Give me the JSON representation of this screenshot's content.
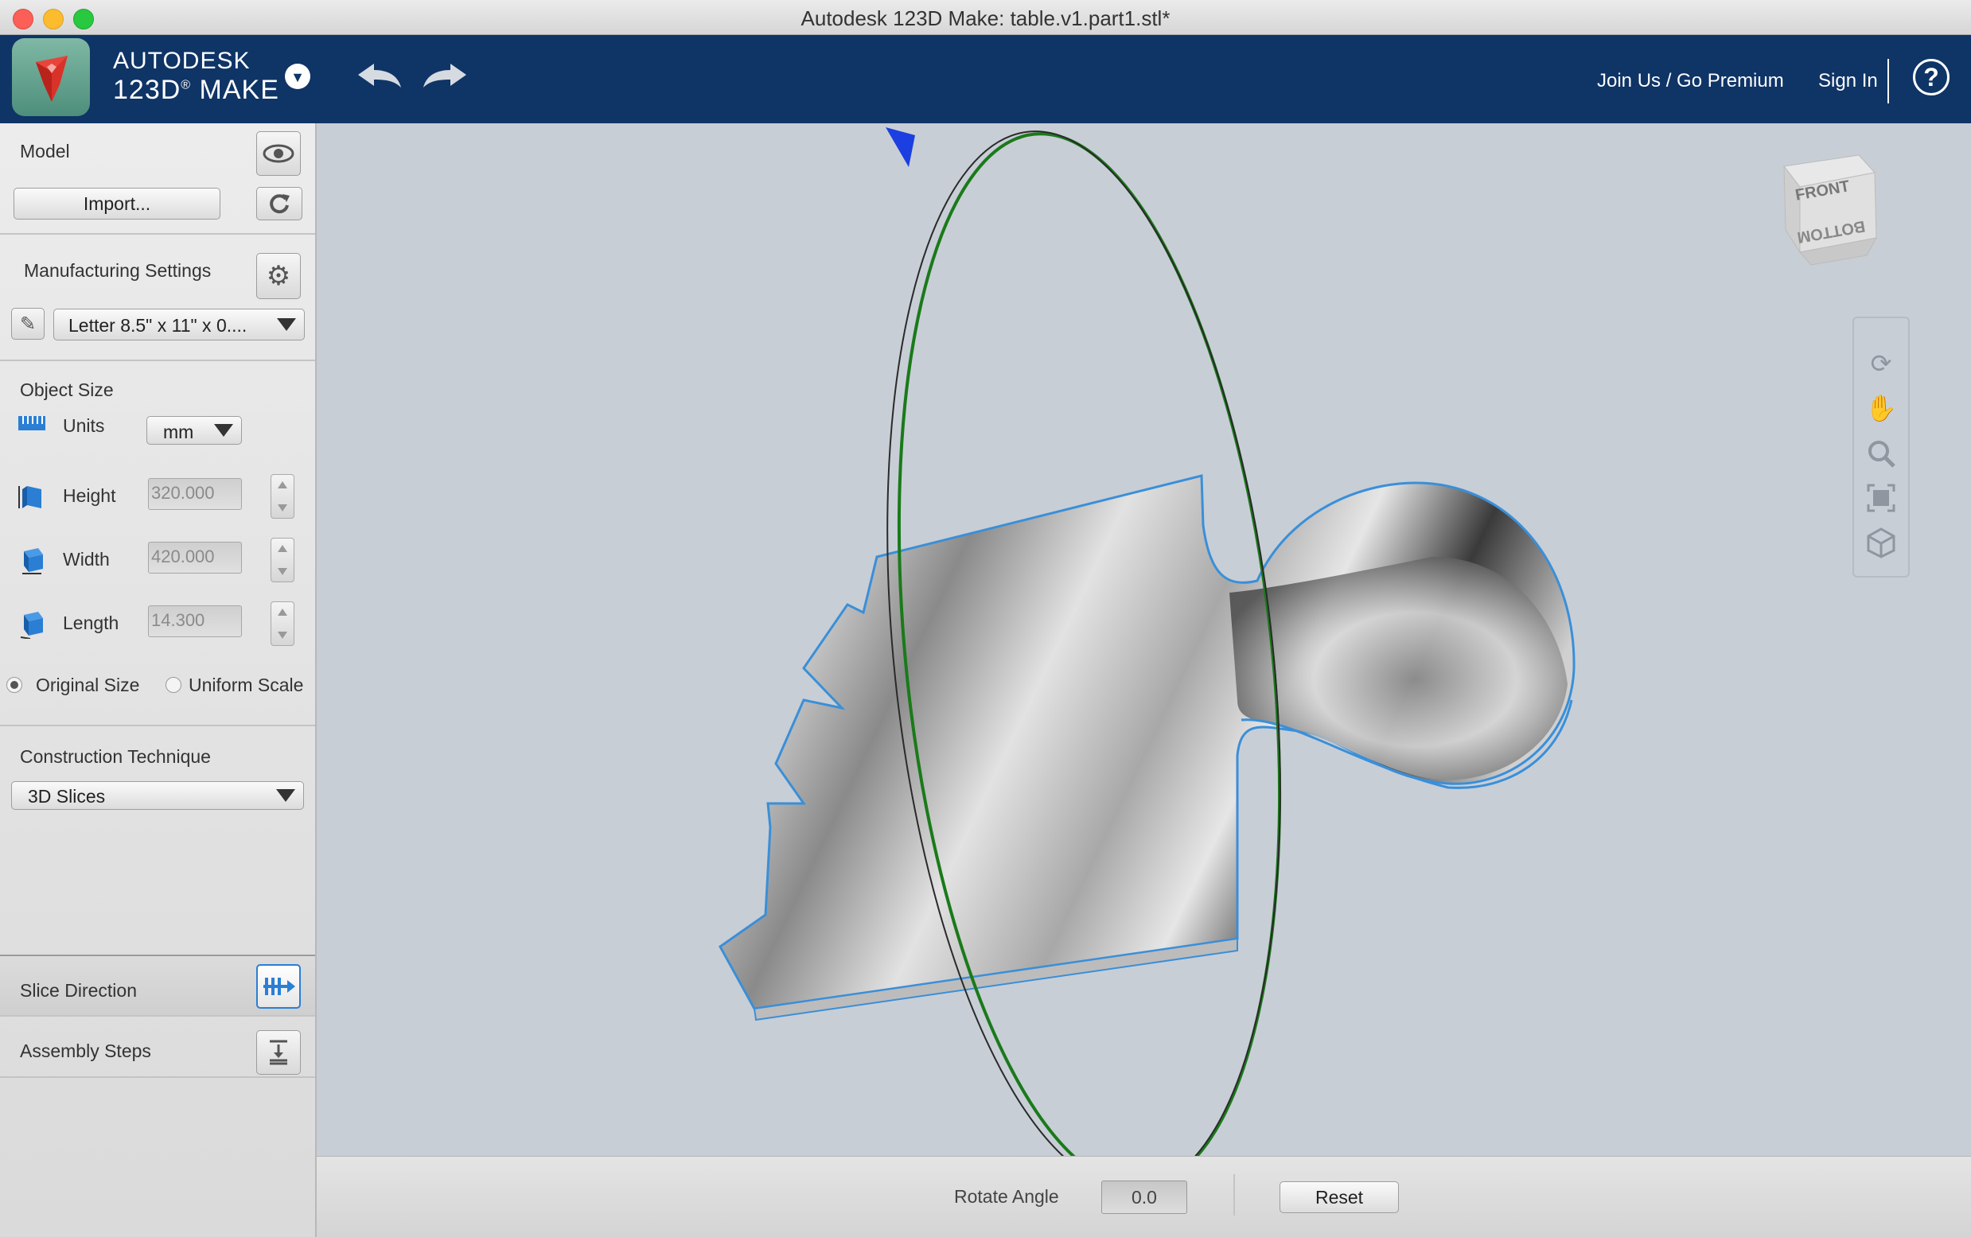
{
  "window": {
    "title": "Autodesk 123D Make: table.v1.part1.stl*"
  },
  "header": {
    "brand_line1": "AUTODESK",
    "brand_line2": "123D",
    "brand_line2_suffix": "MAKE",
    "brand_registered": "®",
    "join_label": "Join Us / Go Premium",
    "signin_label": "Sign In",
    "help_symbol": "?"
  },
  "sidebar": {
    "model": {
      "label": "Model",
      "import_label": "Import..."
    },
    "manufacturing": {
      "label": "Manufacturing Settings",
      "preset_value": "Letter 8.5\" x 11\" x 0...."
    },
    "object_size": {
      "label": "Object Size",
      "units_label": "Units",
      "units_value": "mm",
      "height_label": "Height",
      "height_value": "320.000",
      "width_label": "Width",
      "width_value": "420.000",
      "length_label": "Length",
      "length_value": "14.300",
      "original_size_label": "Original Size",
      "uniform_scale_label": "Uniform Scale"
    },
    "construction": {
      "label": "Construction Technique",
      "value": "3D Slices"
    },
    "slice_direction_label": "Slice Direction",
    "assembly_steps_label": "Assembly Steps"
  },
  "viewcube": {
    "front_label": "FRONT",
    "bottom_label": "BOTTOM"
  },
  "bottombar": {
    "rotate_label": "Rotate Angle",
    "rotate_value": "0.0",
    "reset_label": "Reset"
  },
  "colors": {
    "header_bg": "#0f3466",
    "accent_blue": "#2a7fd4",
    "ring_green": "#1a7a1a",
    "viewport_bg": "#c8ced6"
  }
}
